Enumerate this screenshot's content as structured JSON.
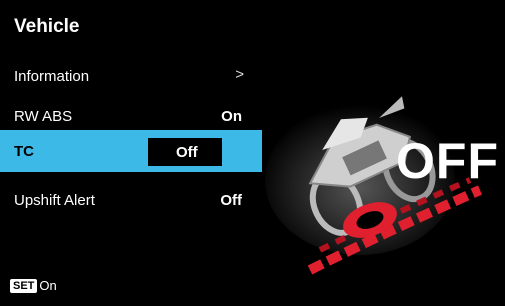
{
  "header": {
    "title": "Vehicle"
  },
  "menu": {
    "items": [
      {
        "label": "Information",
        "value": "",
        "chevron": ">"
      },
      {
        "label": "RW ABS",
        "value": "On"
      },
      {
        "label": "TC",
        "value": "Off",
        "selected": true
      },
      {
        "label": "Upshift Alert",
        "value": "Off"
      }
    ]
  },
  "illustration": {
    "status_text": "OFF",
    "icon": "motorcycle-traction-control-off"
  },
  "footer": {
    "set_badge": "SET",
    "state": "On"
  },
  "colors": {
    "selection": "#3cb9e6",
    "accent_red": "#e0202e",
    "background": "#000000"
  }
}
